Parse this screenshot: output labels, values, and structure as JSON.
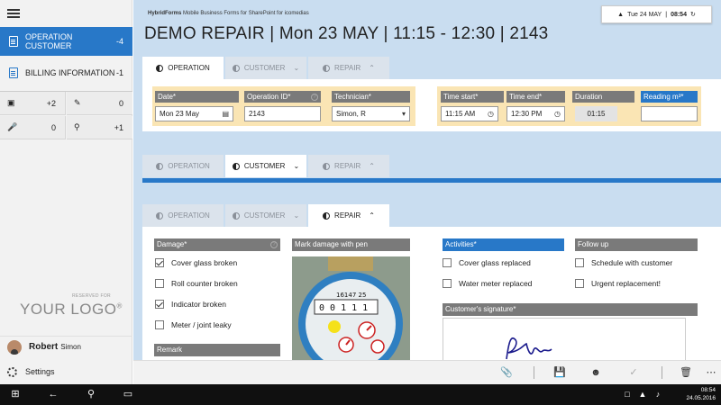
{
  "sidebar": {
    "items": [
      {
        "label": "OPERATION CUSTOMER",
        "count": "-4"
      },
      {
        "label": "BILLING INFORMATION",
        "count": "-1"
      }
    ],
    "grid": [
      {
        "icon": "camera-icon",
        "count": "+2"
      },
      {
        "icon": "pen-icon",
        "count": "0"
      },
      {
        "icon": "microphone-icon",
        "count": "0"
      },
      {
        "icon": "location-pin-icon",
        "count": "+1"
      }
    ],
    "logo_reserved": "RESERVED FOR",
    "logo": "YOUR LOGO",
    "logo_mark": "®",
    "user_first": "Robert",
    "user_last": "Simon",
    "settings": "Settings"
  },
  "header": {
    "app_name": "HybridForms",
    "app_desc": "Mobile Business Forms for SharePoint for icomedias",
    "clock": "Tue 24 MAY",
    "clock_time": "08:54",
    "title": "DEMO REPAIR | Mon 23 MAY | 11:15 - 12:30 | 2143"
  },
  "tabs": {
    "operation": "OPERATION",
    "customer": "CUSTOMER",
    "repair": "REPAIR"
  },
  "operation": {
    "date_label": "Date*",
    "date_value": "Mon 23 May",
    "opid_label": "Operation ID*",
    "opid_value": "2143",
    "tech_label": "Technician*",
    "tech_value": "Simon, R",
    "tstart_label": "Time start*",
    "tstart_value": "11:15 AM",
    "tend_label": "Time end*",
    "tend_value": "12:30 PM",
    "duration_label": "Duration",
    "duration_value": "01:15",
    "reading_label": "Reading m³*",
    "reading_value": ""
  },
  "repair": {
    "damage_label": "Damage*",
    "damage_items": [
      {
        "label": "Cover glass broken",
        "checked": true
      },
      {
        "label": "Roll counter broken",
        "checked": false
      },
      {
        "label": "Indicator broken",
        "checked": true
      },
      {
        "label": "Meter / joint leaky",
        "checked": false
      }
    ],
    "remark_label": "Remark",
    "mark_label": "Mark damage with pen",
    "activities_label": "Activities*",
    "activities": [
      "Cover glass replaced",
      "Water meter replaced"
    ],
    "followup_label": "Follow up",
    "followup": [
      "Schedule with customer",
      "Urgent replacement!"
    ],
    "signature_label": "Customer's signature*",
    "meter_digits": "0 0 1 1 1",
    "meter_serial": "16147 25"
  },
  "taskbar": {
    "time": "08:54",
    "date": "24.05.2016"
  }
}
